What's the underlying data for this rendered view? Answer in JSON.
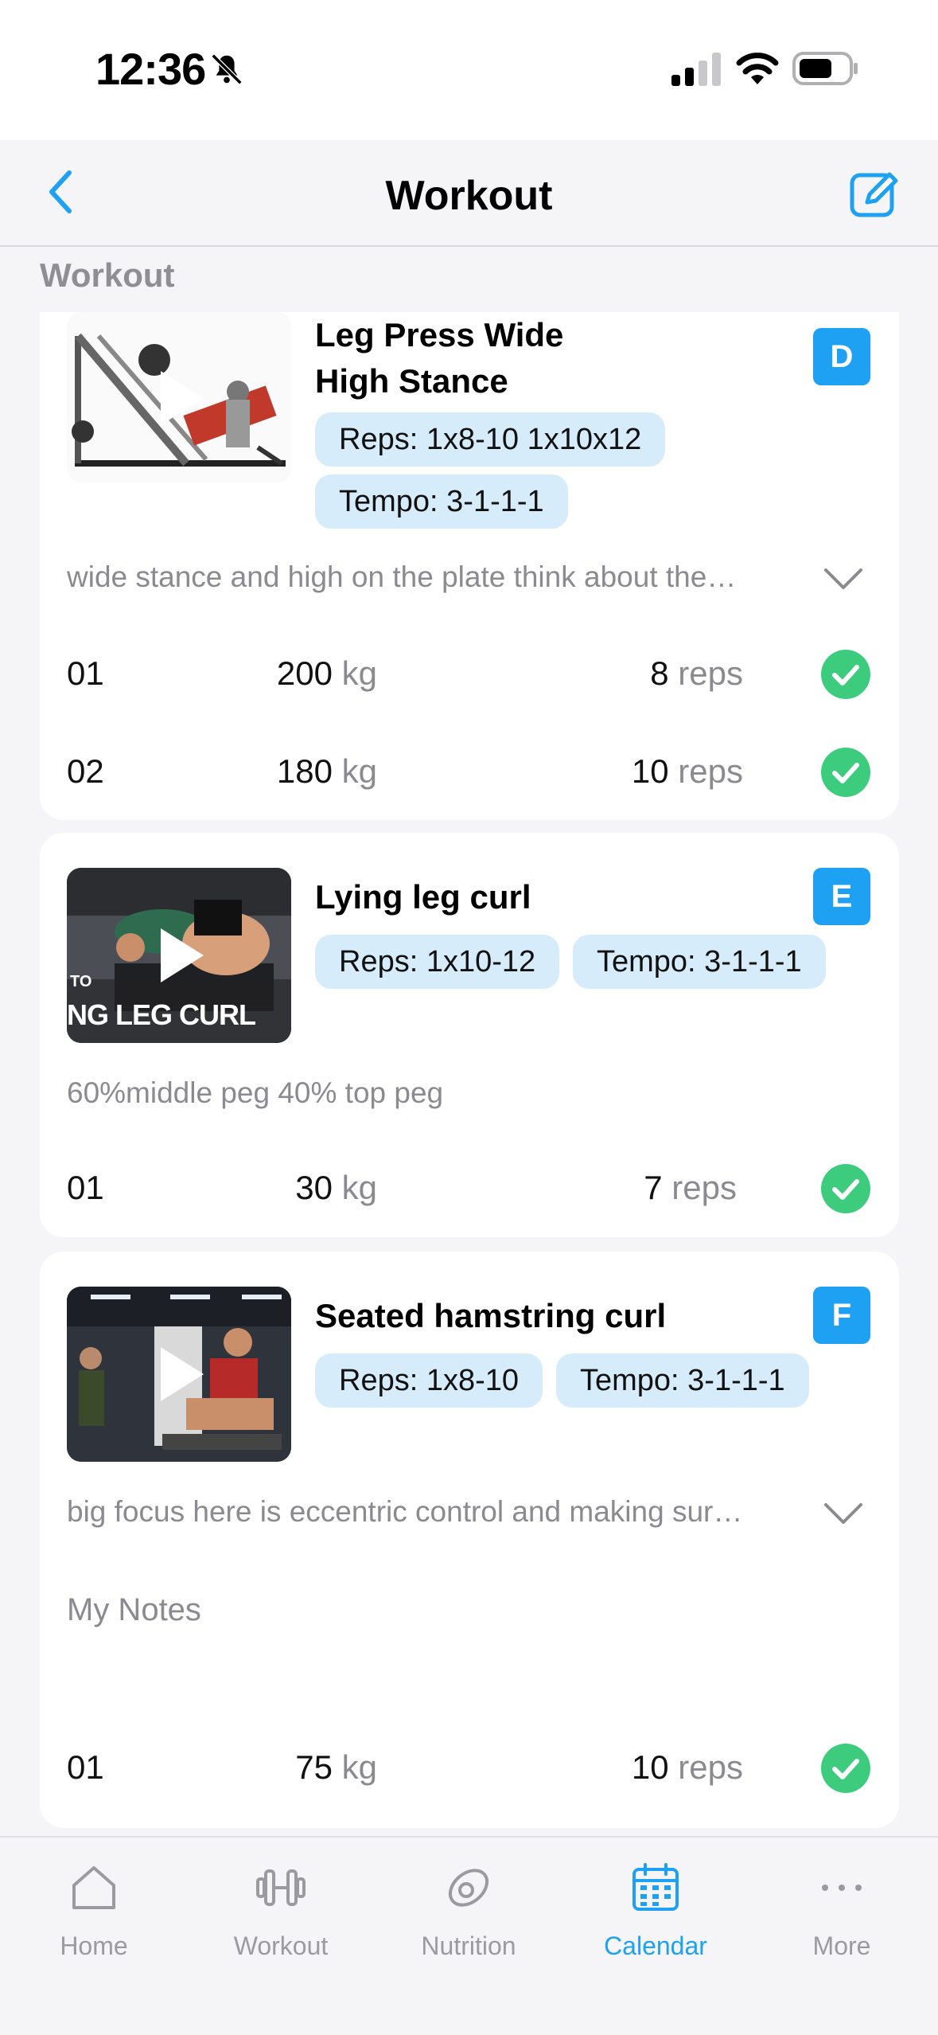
{
  "status_bar": {
    "time": "12:36"
  },
  "header": {
    "title": "Workout"
  },
  "section_label": "Workout",
  "exercises": [
    {
      "title_line1": "Leg Press Wide",
      "title_line2": "High Stance",
      "badge": "D",
      "reps_chip": "Reps: 1x8-10 1x10x12",
      "tempo_chip": "Tempo: 3-1-1-1",
      "note": "wide stance and high on the plate think about the…",
      "sets": [
        {
          "num": "01",
          "weight": "200",
          "weight_unit": "kg",
          "reps": "8",
          "reps_unit": "reps"
        },
        {
          "num": "02",
          "weight": "180",
          "weight_unit": "kg",
          "reps": "10",
          "reps_unit": "reps"
        }
      ]
    },
    {
      "title": "Lying leg curl",
      "badge": "E",
      "reps_chip": "Reps: 1x10-12",
      "tempo_chip": "Tempo: 3-1-1-1",
      "thumb_text_1": "TO",
      "thumb_text_2": "NG LEG CURL",
      "note": "60%middle peg 40% top peg",
      "sets": [
        {
          "num": "01",
          "weight": "30",
          "weight_unit": "kg",
          "reps": "7",
          "reps_unit": "reps"
        }
      ]
    },
    {
      "title": "Seated hamstring curl",
      "badge": "F",
      "reps_chip": "Reps: 1x8-10",
      "tempo_chip": "Tempo: 3-1-1-1",
      "note": "big focus here is eccentric control and making sur…",
      "my_notes_label": "My Notes",
      "sets": [
        {
          "num": "01",
          "weight": "75",
          "weight_unit": "kg",
          "reps": "10",
          "reps_unit": "reps"
        }
      ]
    }
  ],
  "tabs": [
    {
      "label": "Home",
      "icon": "home-icon"
    },
    {
      "label": "Workout",
      "icon": "dumbbell-icon"
    },
    {
      "label": "Nutrition",
      "icon": "nutrition-icon"
    },
    {
      "label": "Calendar",
      "icon": "calendar-icon",
      "active": true
    },
    {
      "label": "More",
      "icon": "more-icon"
    }
  ],
  "colors": {
    "accent": "#1ea1f2",
    "check": "#3dcc7e",
    "chip": "#d6ecfb"
  }
}
